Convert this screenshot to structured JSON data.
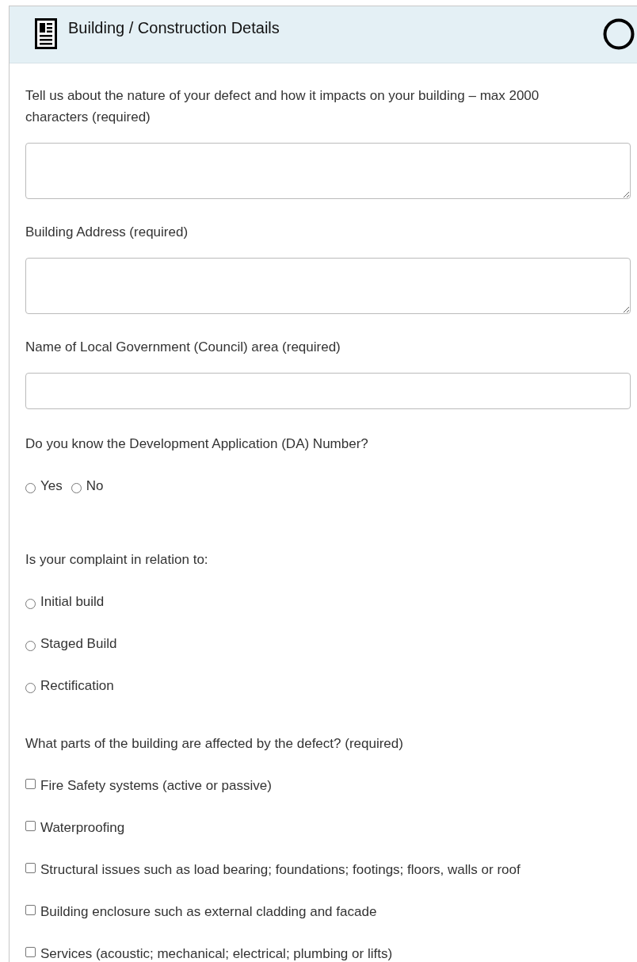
{
  "panel": {
    "title": "Building / Construction Details"
  },
  "fields": [
    {
      "kind": "textarea",
      "label": "Tell us about the nature of your defect and how it impacts on your building – max 2000 characters (required)"
    },
    {
      "kind": "textarea",
      "label": "Building Address (required)"
    },
    {
      "kind": "input",
      "label": "Name of Local Government (Council) area (required)"
    },
    {
      "kind": "radio-row",
      "label": "Do you know the Development Application (DA) Number?",
      "options": [
        {
          "label": "Yes",
          "selected": false
        },
        {
          "label": "No",
          "selected": false
        }
      ]
    },
    {
      "kind": "radio",
      "label": "Is your complaint in relation to:",
      "options": [
        {
          "label": "Initial build",
          "selected": false
        },
        {
          "label": "Staged Build",
          "selected": false
        },
        {
          "label": "Rectification",
          "selected": false
        }
      ]
    },
    {
      "kind": "checkbox",
      "label": "What parts of the building are affected by the defect? (required)",
      "options": [
        {
          "label": "Fire Safety systems (active or passive)",
          "checked": false
        },
        {
          "label": "Waterproofing",
          "checked": false
        },
        {
          "label": "Structural issues such as load bearing; foundations; footings; floors, walls or roof",
          "checked": false
        },
        {
          "label": "Building enclosure such as external cladding and facade",
          "checked": false
        },
        {
          "label": "Services (acoustic; mechanical; electrical; plumbing or lifts)",
          "checked": false
        }
      ]
    }
  ]
}
